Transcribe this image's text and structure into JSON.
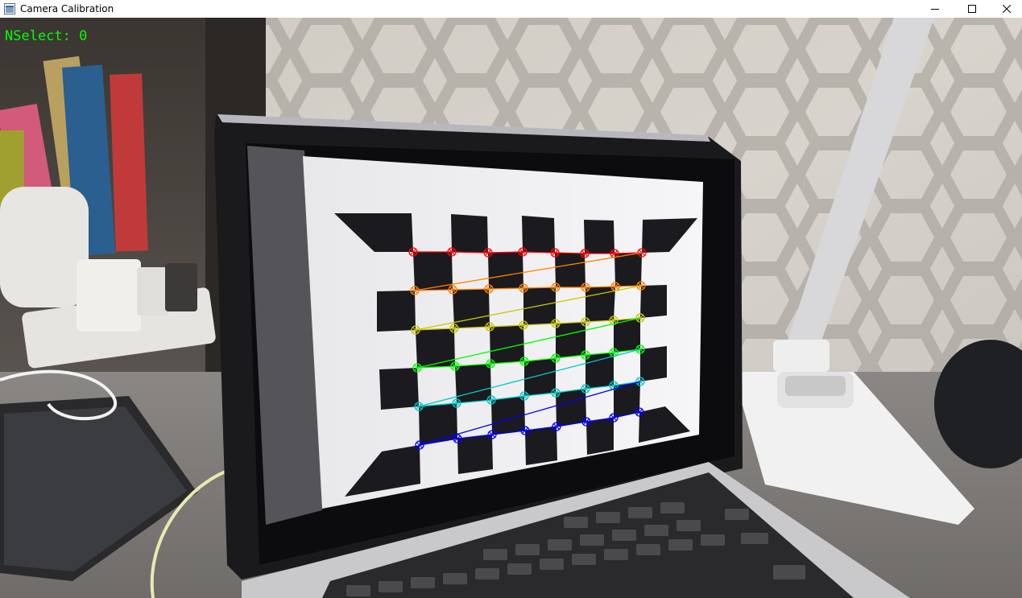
{
  "window": {
    "title": "Camera Calibration",
    "controls": {
      "minimize_icon": "minimize-icon",
      "maximize_icon": "maximize-icon",
      "close_icon": "close-icon"
    }
  },
  "overlay": {
    "nselect_label": "NSelect: 0",
    "text_color": "#00ff00"
  },
  "calibration": {
    "pattern": "checkerboard",
    "corner_rows": 6,
    "corners_per_row": 8,
    "row_colors": [
      "#ff0000",
      "#ff8000",
      "#c8c800",
      "#00ff00",
      "#00c8c8",
      "#0000ff"
    ]
  }
}
